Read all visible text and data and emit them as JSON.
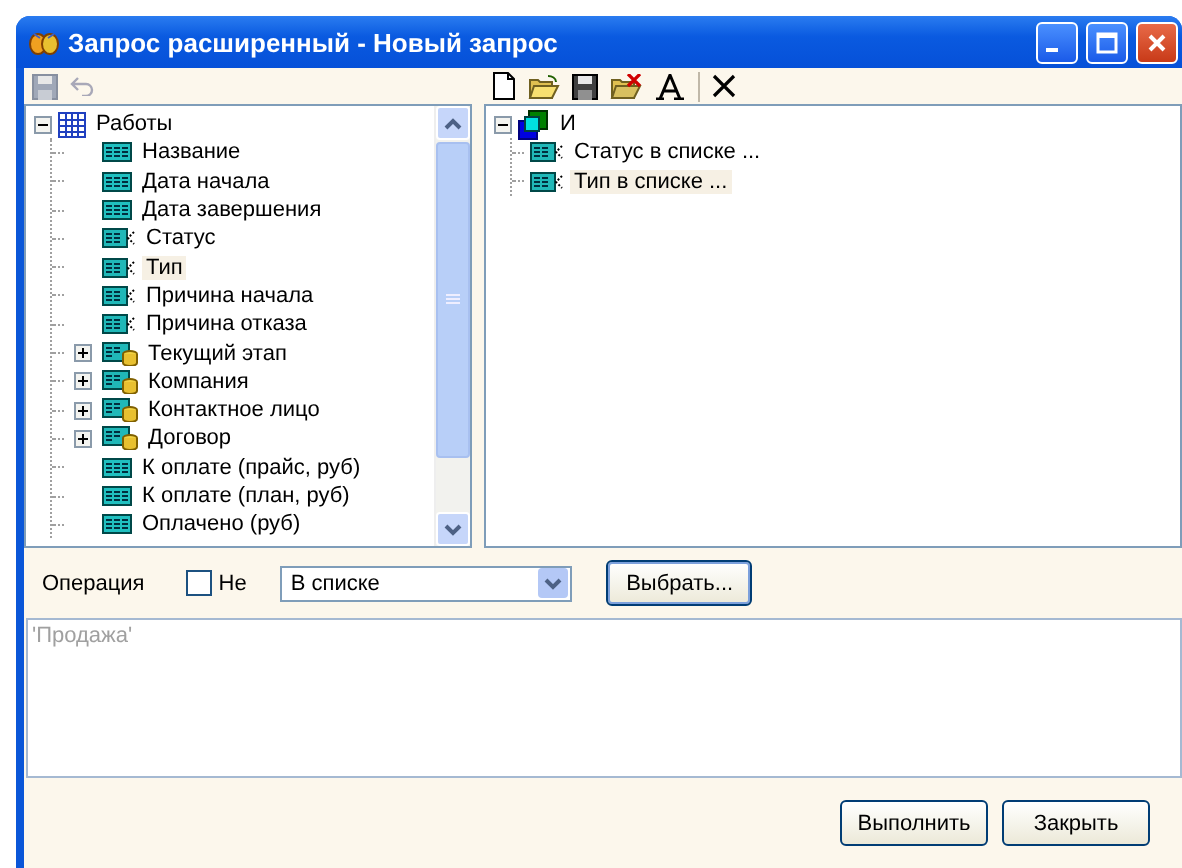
{
  "window": {
    "title": "Запрос расширенный - Новый запрос"
  },
  "field_tree": {
    "label": "Работы",
    "expanded": true,
    "children": [
      {
        "label": "Название",
        "kind": "field",
        "selected": false
      },
      {
        "label": "Дата начала",
        "kind": "field",
        "selected": false
      },
      {
        "label": "Дата завершения",
        "kind": "field",
        "selected": false
      },
      {
        "label": "Статус",
        "kind": "list",
        "selected": false
      },
      {
        "label": "Тип",
        "kind": "list",
        "selected": true
      },
      {
        "label": "Причина начала",
        "kind": "list",
        "selected": false
      },
      {
        "label": "Причина отказа",
        "kind": "list",
        "selected": false
      },
      {
        "label": "Текущий этап",
        "kind": "ref",
        "expanded": false,
        "selected": false
      },
      {
        "label": "Компания",
        "kind": "ref",
        "expanded": false,
        "selected": false
      },
      {
        "label": "Контактное лицо",
        "kind": "ref",
        "expanded": false,
        "selected": false
      },
      {
        "label": "Договор",
        "kind": "ref",
        "expanded": false,
        "selected": false
      },
      {
        "label": "К оплате (прайс, руб)",
        "kind": "field",
        "selected": false
      },
      {
        "label": "К оплате (план, руб)",
        "kind": "field",
        "selected": false
      },
      {
        "label": "Оплачено (руб)",
        "kind": "field",
        "selected": false
      }
    ]
  },
  "condition_tree": {
    "label": "И",
    "expanded": true,
    "children": [
      {
        "label": "Статус в списке ...",
        "selected": false
      },
      {
        "label": "Тип в списке ...",
        "selected": true
      }
    ]
  },
  "operation": {
    "label": "Операция",
    "negate": {
      "label": "Не",
      "checked": false
    },
    "dropdown": {
      "value": "В списке"
    },
    "choose_button": "Выбрать..."
  },
  "values_box": {
    "value": "'Продажа'"
  },
  "buttons": [
    "Выполнить",
    "Закрыть"
  ]
}
